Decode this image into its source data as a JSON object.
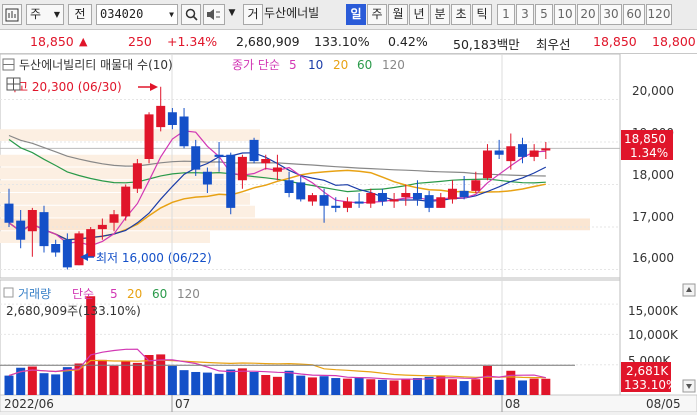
{
  "toolbar": {
    "type_select": "주",
    "period_label": "전",
    "stock_code": "034020",
    "tool_label": "거",
    "stock_name": "두산에너빌",
    "period_buttons": [
      "일",
      "주",
      "월",
      "년",
      "분",
      "초",
      "틱"
    ],
    "selected_period": "일",
    "interval_buttons": [
      "1",
      "3",
      "5",
      "10",
      "20",
      "30",
      "60",
      "120"
    ]
  },
  "quote": {
    "price": "18,850",
    "change": "250",
    "change_pct": "+1.34%",
    "volume": "2,680,909",
    "volume_ratio": "133.10%",
    "turnover": "0.42%",
    "trade_value": "50,183백만",
    "best_ask_label": "최우선",
    "best_ask": "18,850",
    "extra_price": "18,800"
  },
  "price_panel": {
    "title": "두산에너빌리티 매물대 수(10)",
    "ma_label": "종가 단순",
    "ma_periods": [
      "5",
      "10",
      "20",
      "60",
      "120"
    ],
    "high_label": "최고 20,300 (06/30)",
    "low_label": "최저 16,000 (06/22)",
    "y_labels": [
      "20,000",
      "19,000",
      "18,000",
      "17,000",
      "16,000"
    ],
    "current_price_tag": "18,850",
    "current_pct_tag": "1.34%"
  },
  "volume_panel": {
    "title": "거래량",
    "ma_label": "단순",
    "ma_periods": [
      "5",
      "20",
      "60",
      "120"
    ],
    "info": "2,680,909주(133.10%)",
    "y_labels": [
      "15,000K",
      "10,000K",
      "5,000K"
    ],
    "current_volume_tag": "2,681K",
    "current_pct_tag": "133.10%"
  },
  "x_labels": [
    "2022/06",
    "07",
    "08",
    "08/05"
  ],
  "colors": {
    "up": "#e0152a",
    "down": "#1450c8",
    "ma5": "#d238b4",
    "ma10": "#1a3ca8",
    "ma20": "#e8a214",
    "ma60": "#2a9a4a",
    "ma120": "#888888",
    "selected": "#2a5bd8"
  },
  "chart_data": {
    "type": "candlestick",
    "price_range": [
      15800,
      20600
    ],
    "volume_range": [
      0,
      17000000
    ],
    "candles": [
      {
        "o": 17550,
        "h": 17900,
        "l": 17000,
        "c": 17100,
        "v": 3200000
      },
      {
        "o": 17150,
        "h": 17400,
        "l": 16500,
        "c": 16700,
        "v": 4500000
      },
      {
        "o": 16900,
        "h": 17450,
        "l": 16300,
        "c": 17400,
        "v": 4700000
      },
      {
        "o": 17350,
        "h": 17500,
        "l": 16400,
        "c": 16550,
        "v": 3600000
      },
      {
        "o": 16600,
        "h": 16700,
        "l": 16300,
        "c": 16400,
        "v": 3400000
      },
      {
        "o": 16700,
        "h": 16850,
        "l": 16000,
        "c": 16050,
        "v": 4600000
      },
      {
        "o": 16100,
        "h": 16900,
        "l": 16100,
        "c": 16850,
        "v": 5200000
      },
      {
        "o": 16300,
        "h": 17000,
        "l": 16300,
        "c": 16950,
        "v": 16300000
      },
      {
        "o": 16950,
        "h": 17200,
        "l": 16700,
        "c": 17050,
        "v": 5800000
      },
      {
        "o": 17100,
        "h": 17400,
        "l": 16900,
        "c": 17300,
        "v": 4800000
      },
      {
        "o": 17250,
        "h": 18000,
        "l": 17150,
        "c": 17950,
        "v": 5600000
      },
      {
        "o": 17900,
        "h": 18600,
        "l": 17800,
        "c": 18500,
        "v": 5300000
      },
      {
        "o": 18600,
        "h": 19700,
        "l": 18500,
        "c": 19650,
        "v": 6600000
      },
      {
        "o": 19350,
        "h": 20300,
        "l": 19250,
        "c": 19850,
        "v": 6700000
      },
      {
        "o": 19700,
        "h": 19800,
        "l": 19300,
        "c": 19400,
        "v": 4800000
      },
      {
        "o": 19600,
        "h": 19800,
        "l": 18850,
        "c": 18900,
        "v": 4100000
      },
      {
        "o": 18900,
        "h": 19050,
        "l": 18200,
        "c": 18350,
        "v": 3800000
      },
      {
        "o": 18300,
        "h": 18400,
        "l": 17800,
        "c": 18000,
        "v": 3700000
      },
      {
        "o": 18700,
        "h": 19000,
        "l": 18300,
        "c": 18650,
        "v": 3500000
      },
      {
        "o": 18700,
        "h": 18750,
        "l": 17300,
        "c": 17450,
        "v": 4200000
      },
      {
        "o": 18100,
        "h": 18700,
        "l": 17900,
        "c": 18650,
        "v": 4400000
      },
      {
        "o": 19050,
        "h": 19100,
        "l": 18500,
        "c": 18550,
        "v": 3800000
      },
      {
        "o": 18500,
        "h": 18700,
        "l": 18350,
        "c": 18600,
        "v": 3300000
      },
      {
        "o": 18300,
        "h": 18700,
        "l": 18100,
        "c": 18400,
        "v": 3000000
      },
      {
        "o": 18100,
        "h": 18300,
        "l": 17700,
        "c": 17800,
        "v": 4000000
      },
      {
        "o": 18050,
        "h": 18200,
        "l": 17600,
        "c": 17650,
        "v": 3200000
      },
      {
        "o": 17600,
        "h": 17800,
        "l": 17500,
        "c": 17750,
        "v": 2900000
      },
      {
        "o": 17750,
        "h": 17900,
        "l": 17100,
        "c": 17500,
        "v": 3100000
      },
      {
        "o": 17500,
        "h": 17700,
        "l": 17350,
        "c": 17450,
        "v": 2800000
      },
      {
        "o": 17450,
        "h": 17700,
        "l": 17350,
        "c": 17600,
        "v": 2700000
      },
      {
        "o": 17600,
        "h": 17800,
        "l": 17450,
        "c": 17550,
        "v": 2900000
      },
      {
        "o": 17550,
        "h": 17900,
        "l": 17450,
        "c": 17800,
        "v": 2600000
      },
      {
        "o": 17800,
        "h": 17900,
        "l": 17500,
        "c": 17600,
        "v": 2500000
      },
      {
        "o": 17600,
        "h": 17800,
        "l": 17450,
        "c": 17650,
        "v": 2400000
      },
      {
        "o": 17700,
        "h": 18000,
        "l": 17500,
        "c": 17800,
        "v": 2700000
      },
      {
        "o": 17800,
        "h": 18100,
        "l": 17500,
        "c": 17650,
        "v": 2800000
      },
      {
        "o": 17750,
        "h": 17850,
        "l": 17350,
        "c": 17450,
        "v": 3000000
      },
      {
        "o": 17450,
        "h": 17800,
        "l": 17450,
        "c": 17700,
        "v": 3200000
      },
      {
        "o": 17650,
        "h": 18100,
        "l": 17550,
        "c": 17900,
        "v": 2600000
      },
      {
        "o": 17850,
        "h": 18200,
        "l": 17650,
        "c": 17700,
        "v": 2300000
      },
      {
        "o": 17850,
        "h": 18300,
        "l": 17800,
        "c": 18100,
        "v": 2600000
      },
      {
        "o": 18150,
        "h": 18950,
        "l": 18100,
        "c": 18800,
        "v": 4800000
      },
      {
        "o": 18800,
        "h": 19050,
        "l": 18600,
        "c": 18700,
        "v": 2500000
      },
      {
        "o": 18550,
        "h": 19200,
        "l": 18350,
        "c": 18900,
        "v": 4000000
      },
      {
        "o": 18950,
        "h": 19100,
        "l": 18500,
        "c": 18650,
        "v": 2400000
      },
      {
        "o": 18650,
        "h": 18950,
        "l": 18550,
        "c": 18800,
        "v": 2700000
      },
      {
        "o": 18800,
        "h": 19000,
        "l": 18600,
        "c": 18850,
        "v": 2680909
      }
    ]
  }
}
